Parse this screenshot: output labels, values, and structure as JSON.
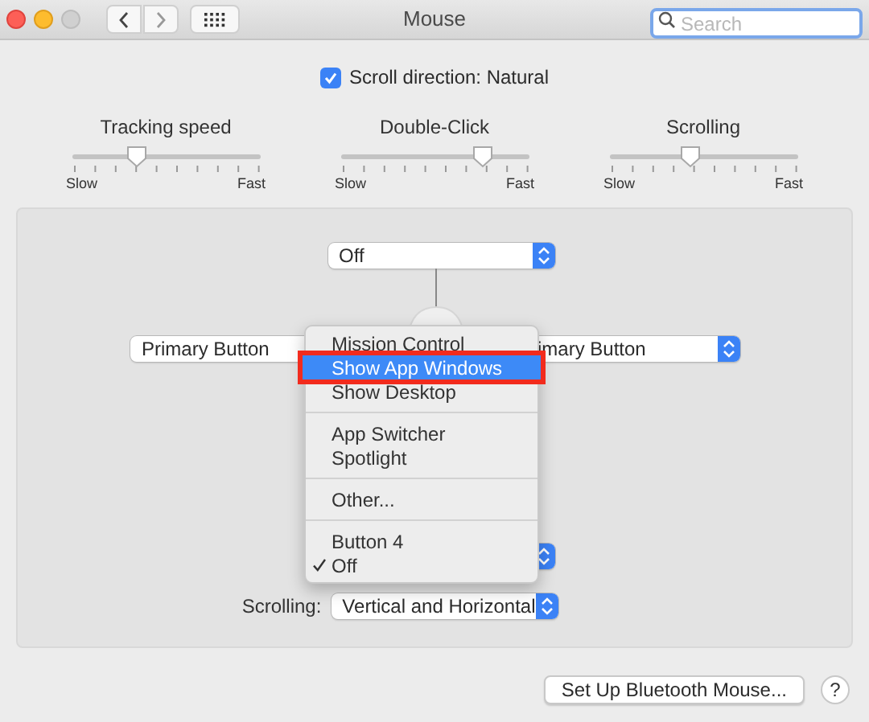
{
  "window": {
    "title": "Mouse"
  },
  "search": {
    "placeholder": "Search"
  },
  "scroll_direction": {
    "label": "Scroll direction: Natural",
    "checked": true
  },
  "sliders": [
    {
      "label": "Tracking speed",
      "level": 0.35,
      "min_label": "Slow",
      "max_label": "Fast"
    },
    {
      "label": "Double-Click",
      "level": 0.76,
      "min_label": "Slow",
      "max_label": "Fast"
    },
    {
      "label": "Scrolling",
      "level": 0.43,
      "min_label": "Slow",
      "max_label": "Fast"
    }
  ],
  "top_popup": {
    "value": "Off"
  },
  "left_popup": {
    "value": "Primary Button"
  },
  "right_popup": {
    "value": "imary Button"
  },
  "menu": [
    {
      "kind": "item",
      "label": "Mission Control",
      "selected": false,
      "checked": false
    },
    {
      "kind": "item",
      "label": "Show App Windows",
      "selected": true,
      "checked": false
    },
    {
      "kind": "item",
      "label": "Show Desktop",
      "selected": false,
      "checked": false
    },
    {
      "kind": "separator"
    },
    {
      "kind": "item",
      "label": "App Switcher",
      "selected": false,
      "checked": false
    },
    {
      "kind": "item",
      "label": "Spotlight",
      "selected": false,
      "checked": false
    },
    {
      "kind": "separator"
    },
    {
      "kind": "item",
      "label": "Other...",
      "selected": false,
      "checked": false
    },
    {
      "kind": "separator"
    },
    {
      "kind": "item",
      "label": "Button 4",
      "selected": false,
      "checked": false
    },
    {
      "kind": "item",
      "label": "Off",
      "selected": false,
      "checked": true
    }
  ],
  "scrolling": {
    "label": "Scrolling:",
    "value": "Vertical and Horizontal"
  },
  "setup_button": "Set Up Bluetooth Mouse...",
  "help_button": "?"
}
